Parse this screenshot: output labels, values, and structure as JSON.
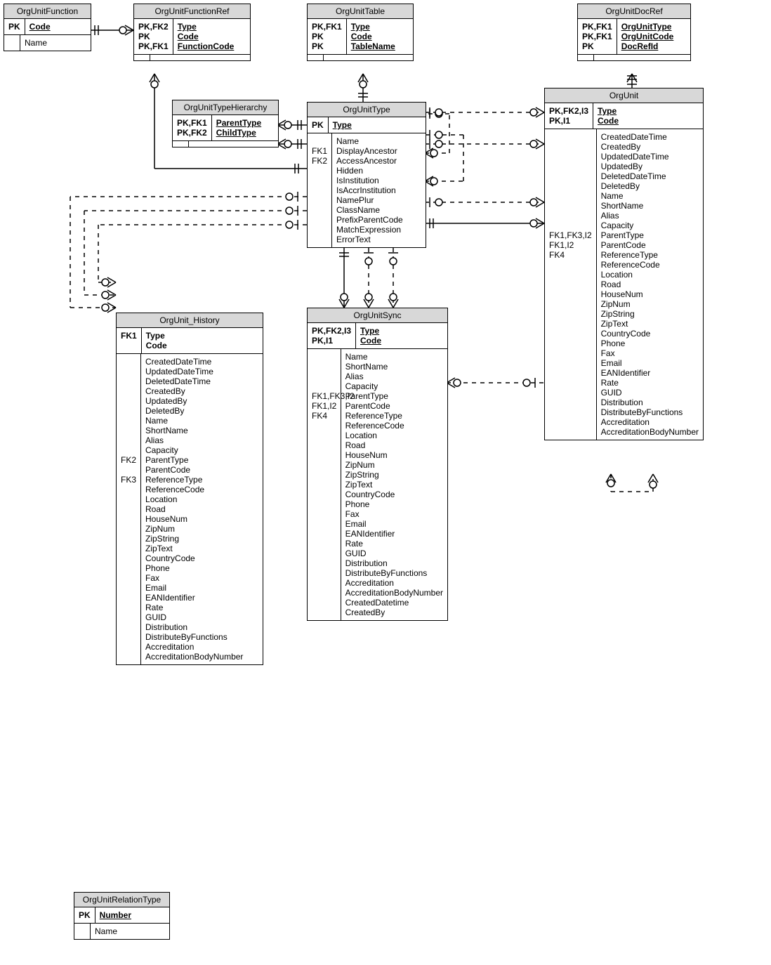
{
  "entities": {
    "orgUnitFunction": {
      "title": "OrgUnitFunction",
      "pk": [
        {
          "keys": "PK",
          "name": "Code",
          "u": true
        }
      ],
      "body": [
        {
          "keys": "",
          "name": "Name"
        }
      ]
    },
    "orgUnitFunctionRef": {
      "title": "OrgUnitFunctionRef",
      "pk": [
        {
          "keys": "PK,FK2",
          "name": "Type",
          "u": true
        },
        {
          "keys": "PK",
          "name": "Code",
          "u": true
        },
        {
          "keys": "PK,FK1",
          "name": "FunctionCode",
          "u": true
        }
      ],
      "body": [
        {
          "keys": "",
          "name": ""
        }
      ]
    },
    "orgUnitTable": {
      "title": "OrgUnitTable",
      "pk": [
        {
          "keys": "PK,FK1",
          "name": "Type",
          "u": true
        },
        {
          "keys": "PK",
          "name": "Code",
          "u": true
        },
        {
          "keys": "PK",
          "name": "TableName",
          "u": true
        }
      ],
      "body": [
        {
          "keys": "",
          "name": ""
        }
      ]
    },
    "orgUnitDocRef": {
      "title": "OrgUnitDocRef",
      "pk": [
        {
          "keys": "PK,FK1",
          "name": "OrgUnitType",
          "u": true
        },
        {
          "keys": "PK,FK1",
          "name": "OrgUnitCode",
          "u": true
        },
        {
          "keys": "PK",
          "name": "DocRefId",
          "u": true
        }
      ],
      "body": [
        {
          "keys": "",
          "name": ""
        }
      ]
    },
    "orgUnitTypeHierarchy": {
      "title": "OrgUnitTypeHierarchy",
      "pk": [
        {
          "keys": "PK,FK1",
          "name": "ParentType",
          "u": true
        },
        {
          "keys": "PK,FK2",
          "name": "ChildType",
          "u": true
        }
      ],
      "body": [
        {
          "keys": "",
          "name": ""
        }
      ]
    },
    "orgUnitType": {
      "title": "OrgUnitType",
      "pk": [
        {
          "keys": "PK",
          "name": "Type",
          "u": true
        }
      ],
      "body": [
        {
          "keys": "",
          "name": "Name"
        },
        {
          "keys": "FK1",
          "name": "DisplayAncestor"
        },
        {
          "keys": "FK2",
          "name": "AccessAncestor"
        },
        {
          "keys": "",
          "name": "Hidden"
        },
        {
          "keys": "",
          "name": "IsInstitution"
        },
        {
          "keys": "",
          "name": "IsAccrInstitution"
        },
        {
          "keys": "",
          "name": "NamePlur"
        },
        {
          "keys": "",
          "name": "ClassName"
        },
        {
          "keys": "",
          "name": "PrefixParentCode"
        },
        {
          "keys": "",
          "name": "MatchExpression"
        },
        {
          "keys": "",
          "name": "ErrorText"
        }
      ]
    },
    "orgUnit": {
      "title": "OrgUnit",
      "pk": [
        {
          "keys": "PK,FK2,I3",
          "name": "Type",
          "u": true
        },
        {
          "keys": "PK,I1",
          "name": "Code",
          "u": true
        }
      ],
      "body": [
        {
          "keys": "",
          "name": "CreatedDateTime"
        },
        {
          "keys": "",
          "name": "CreatedBy"
        },
        {
          "keys": "",
          "name": "UpdatedDateTime"
        },
        {
          "keys": "",
          "name": "UpdatedBy"
        },
        {
          "keys": "",
          "name": "DeletedDateTime"
        },
        {
          "keys": "",
          "name": "DeletedBy"
        },
        {
          "keys": "",
          "name": "Name"
        },
        {
          "keys": "",
          "name": "ShortName"
        },
        {
          "keys": "",
          "name": "Alias"
        },
        {
          "keys": "",
          "name": "Capacity"
        },
        {
          "keys": "FK1,FK3,I2",
          "name": "ParentType"
        },
        {
          "keys": "FK1,I2",
          "name": "ParentCode"
        },
        {
          "keys": "FK4",
          "name": "ReferenceType"
        },
        {
          "keys": "",
          "name": "ReferenceCode"
        },
        {
          "keys": "",
          "name": "Location"
        },
        {
          "keys": "",
          "name": "Road"
        },
        {
          "keys": "",
          "name": "HouseNum"
        },
        {
          "keys": "",
          "name": "ZipNum"
        },
        {
          "keys": "",
          "name": "ZipString"
        },
        {
          "keys": "",
          "name": "ZipText"
        },
        {
          "keys": "",
          "name": "CountryCode"
        },
        {
          "keys": "",
          "name": "Phone"
        },
        {
          "keys": "",
          "name": "Fax"
        },
        {
          "keys": "",
          "name": "Email"
        },
        {
          "keys": "",
          "name": "EANIdentifier"
        },
        {
          "keys": "",
          "name": "Rate"
        },
        {
          "keys": "",
          "name": "GUID"
        },
        {
          "keys": "",
          "name": "Distribution"
        },
        {
          "keys": "",
          "name": "DistributeByFunctions"
        },
        {
          "keys": "",
          "name": "Accreditation"
        },
        {
          "keys": "",
          "name": "AccreditationBodyNumber"
        }
      ]
    },
    "orgUnitHistory": {
      "title": "OrgUnit_History",
      "pk": [
        {
          "keys": "FK1",
          "name": "Type"
        },
        {
          "keys": "",
          "name": "Code"
        }
      ],
      "body": [
        {
          "keys": "",
          "name": "CreatedDateTime"
        },
        {
          "keys": "",
          "name": "UpdatedDateTime"
        },
        {
          "keys": "",
          "name": "DeletedDateTime"
        },
        {
          "keys": "",
          "name": "CreatedBy"
        },
        {
          "keys": "",
          "name": "UpdatedBy"
        },
        {
          "keys": "",
          "name": "DeletedBy"
        },
        {
          "keys": "",
          "name": "Name"
        },
        {
          "keys": "",
          "name": "ShortName"
        },
        {
          "keys": "",
          "name": "Alias"
        },
        {
          "keys": "",
          "name": "Capacity"
        },
        {
          "keys": "FK2",
          "name": "ParentType"
        },
        {
          "keys": "",
          "name": "ParentCode"
        },
        {
          "keys": "FK3",
          "name": "ReferenceType"
        },
        {
          "keys": "",
          "name": "ReferenceCode"
        },
        {
          "keys": "",
          "name": "Location"
        },
        {
          "keys": "",
          "name": "Road"
        },
        {
          "keys": "",
          "name": "HouseNum"
        },
        {
          "keys": "",
          "name": "ZipNum"
        },
        {
          "keys": "",
          "name": "ZipString"
        },
        {
          "keys": "",
          "name": "ZipText"
        },
        {
          "keys": "",
          "name": "CountryCode"
        },
        {
          "keys": "",
          "name": "Phone"
        },
        {
          "keys": "",
          "name": "Fax"
        },
        {
          "keys": "",
          "name": "Email"
        },
        {
          "keys": "",
          "name": "EANIdentifier"
        },
        {
          "keys": "",
          "name": "Rate"
        },
        {
          "keys": "",
          "name": "GUID"
        },
        {
          "keys": "",
          "name": "Distribution"
        },
        {
          "keys": "",
          "name": "DistributeByFunctions"
        },
        {
          "keys": "",
          "name": "Accreditation"
        },
        {
          "keys": "",
          "name": "AccreditationBodyNumber"
        }
      ]
    },
    "orgUnitSync": {
      "title": "OrgUnitSync",
      "pk": [
        {
          "keys": "PK,FK2,I3",
          "name": "Type",
          "u": true
        },
        {
          "keys": "PK,I1",
          "name": "Code",
          "u": true
        }
      ],
      "body": [
        {
          "keys": "",
          "name": "Name"
        },
        {
          "keys": "",
          "name": "ShortName"
        },
        {
          "keys": "",
          "name": "Alias"
        },
        {
          "keys": "",
          "name": "Capacity"
        },
        {
          "keys": "FK1,FK3,I2",
          "name": "ParentType"
        },
        {
          "keys": "FK1,I2",
          "name": "ParentCode"
        },
        {
          "keys": "FK4",
          "name": "ReferenceType"
        },
        {
          "keys": "",
          "name": "ReferenceCode"
        },
        {
          "keys": "",
          "name": "Location"
        },
        {
          "keys": "",
          "name": "Road"
        },
        {
          "keys": "",
          "name": "HouseNum"
        },
        {
          "keys": "",
          "name": "ZipNum"
        },
        {
          "keys": "",
          "name": "ZipString"
        },
        {
          "keys": "",
          "name": "ZipText"
        },
        {
          "keys": "",
          "name": "CountryCode"
        },
        {
          "keys": "",
          "name": "Phone"
        },
        {
          "keys": "",
          "name": "Fax"
        },
        {
          "keys": "",
          "name": "Email"
        },
        {
          "keys": "",
          "name": "EANIdentifier"
        },
        {
          "keys": "",
          "name": "Rate"
        },
        {
          "keys": "",
          "name": "GUID"
        },
        {
          "keys": "",
          "name": "Distribution"
        },
        {
          "keys": "",
          "name": "DistributeByFunctions"
        },
        {
          "keys": "",
          "name": "Accreditation"
        },
        {
          "keys": "",
          "name": "AccreditationBodyNumber"
        },
        {
          "keys": "",
          "name": "CreatedDatetime"
        },
        {
          "keys": "",
          "name": "CreatedBy"
        }
      ]
    },
    "orgUnitRelationType": {
      "title": "OrgUnitRelationType",
      "pk": [
        {
          "keys": "PK",
          "name": "Number",
          "u": true
        }
      ],
      "body": [
        {
          "keys": "",
          "name": "Name"
        }
      ]
    }
  },
  "relationships": [
    {
      "from": "OrgUnitFunction",
      "to": "OrgUnitFunctionRef",
      "style": "solid"
    },
    {
      "from": "OrgUnitType",
      "to": "OrgUnitFunctionRef",
      "style": "solid"
    },
    {
      "from": "OrgUnitType",
      "to": "OrgUnitTable",
      "style": "solid"
    },
    {
      "from": "OrgUnitType",
      "to": "OrgUnitTypeHierarchy",
      "style": "solid",
      "note": "two"
    },
    {
      "from": "OrgUnitType",
      "to": "OrgUnitType",
      "style": "dashed",
      "note": "self x2"
    },
    {
      "from": "OrgUnitType",
      "to": "OrgUnit",
      "style": "solid+dashed",
      "note": "multiple"
    },
    {
      "from": "OrgUnitType",
      "to": "OrgUnitSync",
      "style": "solid+dashed"
    },
    {
      "from": "OrgUnitType",
      "to": "OrgUnit_History",
      "style": "dashed",
      "note": "multiple"
    },
    {
      "from": "OrgUnit",
      "to": "OrgUnitDocRef",
      "style": "solid"
    },
    {
      "from": "OrgUnit",
      "to": "OrgUnit",
      "style": "dashed",
      "note": "self"
    },
    {
      "from": "OrgUnit",
      "to": "OrgUnitSync",
      "style": "dashed"
    }
  ]
}
